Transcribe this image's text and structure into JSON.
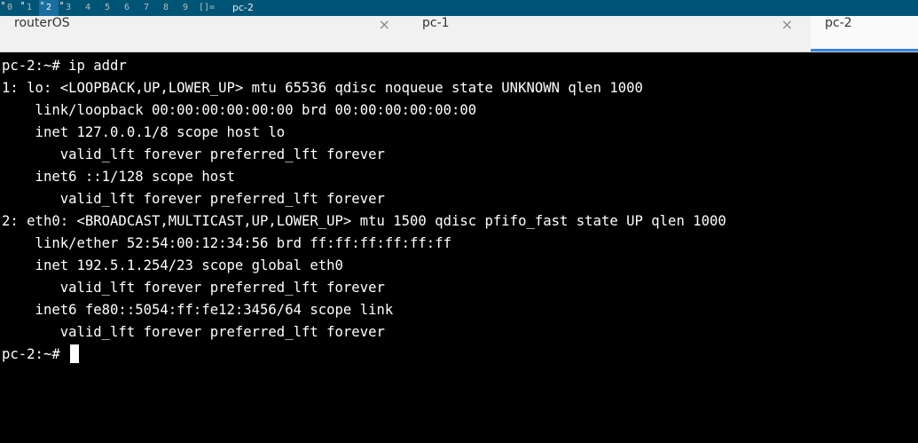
{
  "status_bar": {
    "tags": [
      "0",
      "1",
      "2",
      "3",
      "4",
      "5",
      "6",
      "7",
      "8",
      "9"
    ],
    "selected_tag": "2",
    "occupied_tags": [
      "0",
      "1",
      "2",
      "3"
    ],
    "layout_symbol": "[]=",
    "window_title": "pc-2"
  },
  "tabs": [
    {
      "label": "routerOS",
      "close": "×",
      "active": false
    },
    {
      "label": "pc-1",
      "close": "×",
      "active": false
    },
    {
      "label": "pc-2",
      "active": true
    }
  ],
  "terminal": {
    "lines": [
      "pc-2:~# ip addr",
      "1: lo: <LOOPBACK,UP,LOWER_UP> mtu 65536 qdisc noqueue state UNKNOWN qlen 1000",
      "    link/loopback 00:00:00:00:00:00 brd 00:00:00:00:00:00",
      "    inet 127.0.0.1/8 scope host lo",
      "       valid_lft forever preferred_lft forever",
      "    inet6 ::1/128 scope host",
      "       valid_lft forever preferred_lft forever",
      "2: eth0: <BROADCAST,MULTICAST,UP,LOWER_UP> mtu 1500 qdisc pfifo_fast state UP qlen 1000",
      "    link/ether 52:54:00:12:34:56 brd ff:ff:ff:ff:ff:ff",
      "    inet 192.5.1.254/23 scope global eth0",
      "       valid_lft forever preferred_lft forever",
      "    inet6 fe80::5054:ff:fe12:3456/64 scope link",
      "       valid_lft forever preferred_lft forever"
    ],
    "prompt": "pc-2:~# "
  },
  "colors": {
    "status_bar_bg": "#005577",
    "tab_accent": "#3584e4",
    "terminal_bg": "#000000",
    "terminal_fg": "#ffffff"
  }
}
